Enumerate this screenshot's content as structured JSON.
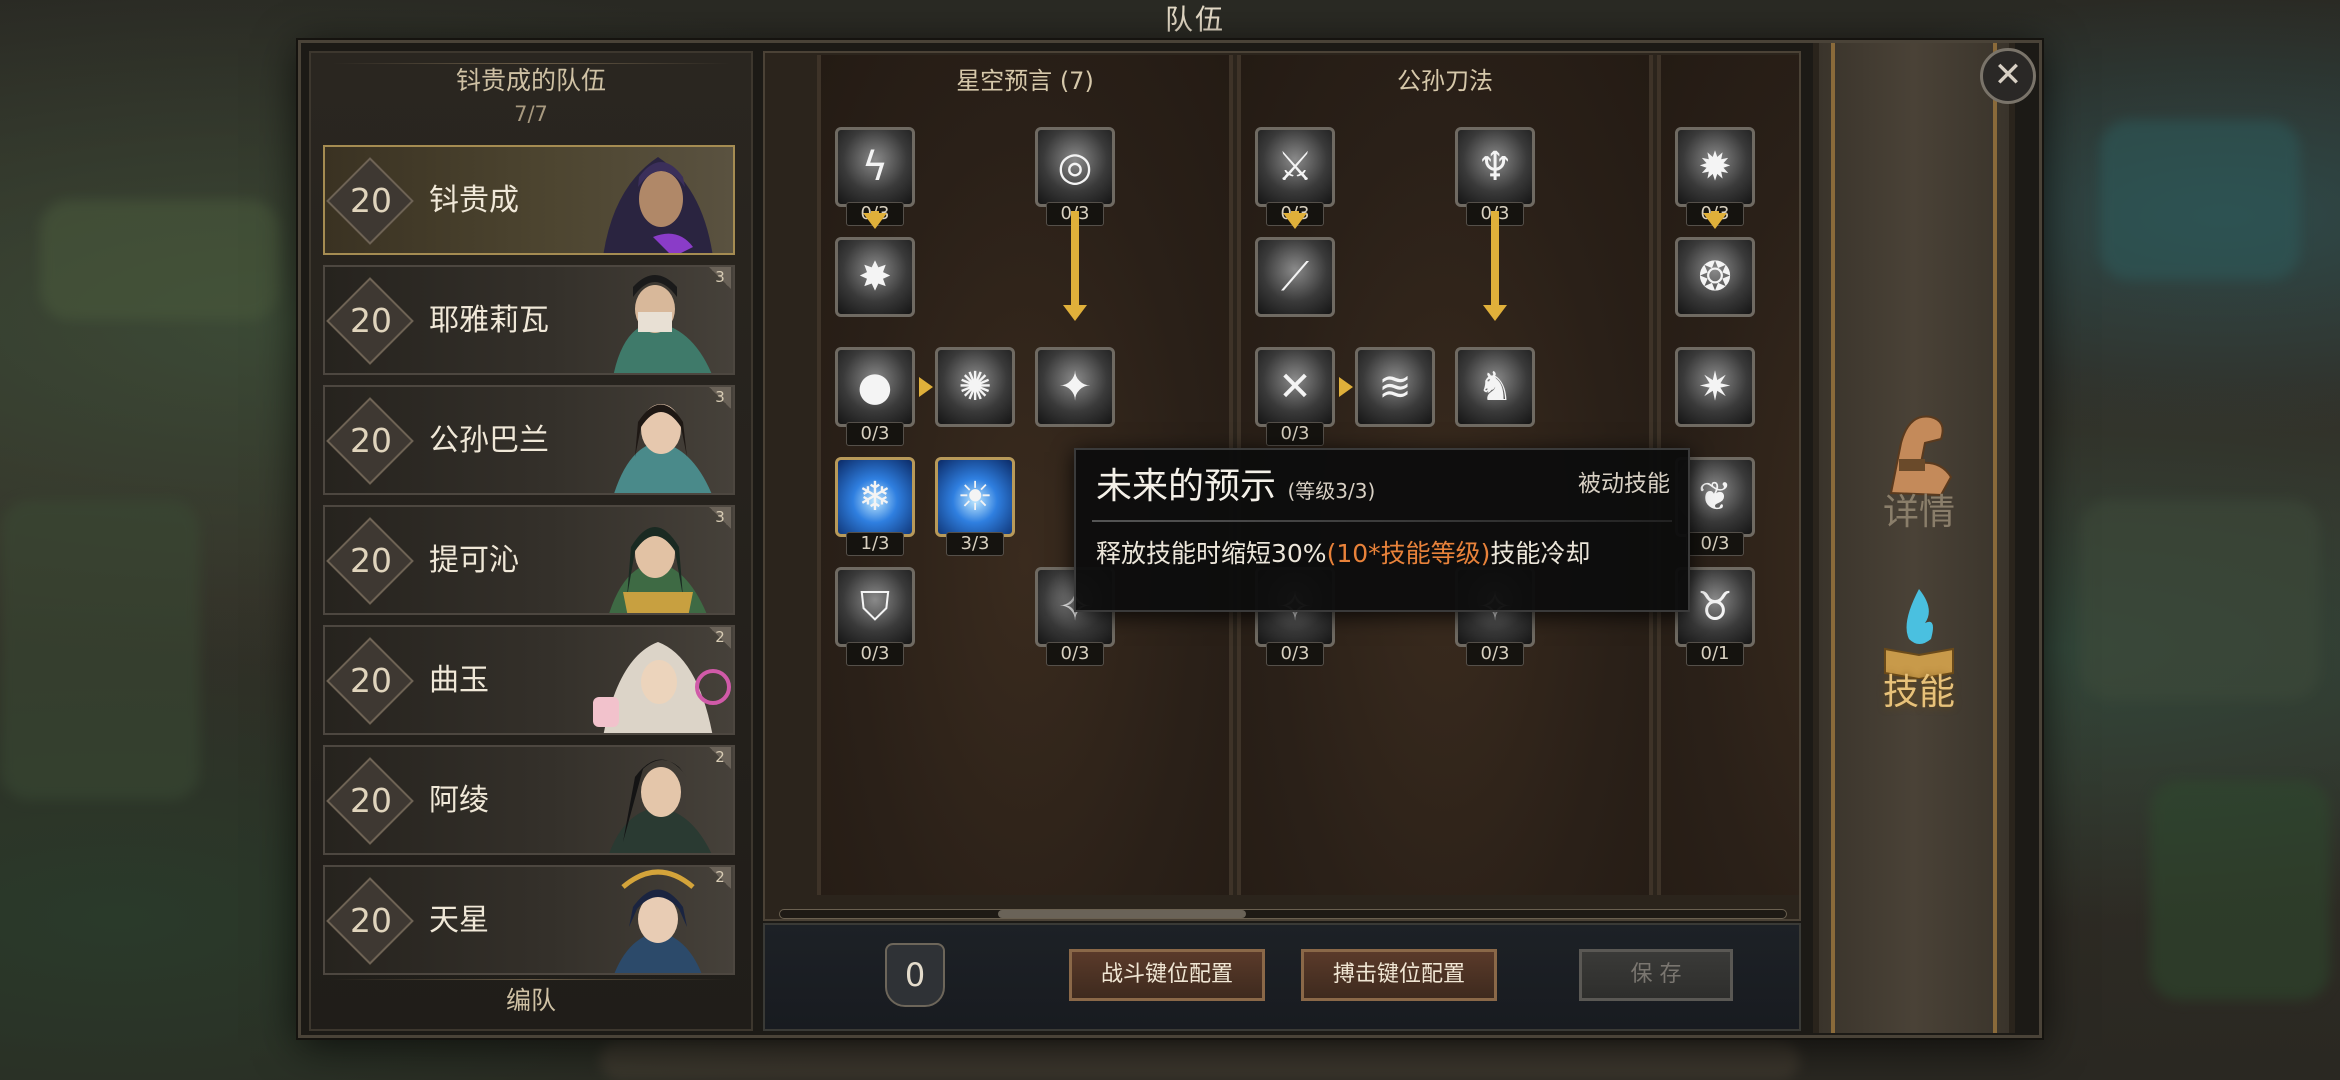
{
  "header": {
    "title": "队伍"
  },
  "roster": {
    "title": "钭贵成的队伍",
    "count": "7/7",
    "footer": "编队",
    "members": [
      {
        "level": "20",
        "name": "钭贵成",
        "badge": ""
      },
      {
        "level": "20",
        "name": "耶雅莉瓦",
        "badge": "3"
      },
      {
        "level": "20",
        "name": "公孙巴兰",
        "badge": "3"
      },
      {
        "level": "20",
        "name": "提可沁",
        "badge": "3"
      },
      {
        "level": "20",
        "name": "曲玉",
        "badge": "2"
      },
      {
        "level": "20",
        "name": "阿绫",
        "badge": "2"
      },
      {
        "level": "20",
        "name": "天星",
        "badge": "2"
      }
    ]
  },
  "skill_trees": [
    {
      "title": "星空预言 (7)",
      "nodes": [
        "0/3",
        "0/3",
        "0/3",
        "1/3",
        "3/3",
        "0/3",
        "0/3"
      ]
    },
    {
      "title": "公孙刀法",
      "nodes": [
        "0/3",
        "0/3",
        "0/3",
        "0/3",
        "0/3"
      ]
    },
    {
      "title": "",
      "nodes": [
        "0/3",
        "0/3",
        "0/1"
      ]
    }
  ],
  "tooltip": {
    "name": "未来的预示",
    "level": "(等级3/3)",
    "type": "被动技能",
    "desc_prefix": "释放技能时缩短30%",
    "desc_highlight": "(10*技能等级)",
    "desc_suffix": "技能冷却",
    "highlight_color": "#e8823a"
  },
  "bottom": {
    "points": "0",
    "battle_keys": "战斗键位配置",
    "grapple_keys": "搏击键位配置",
    "save": "保 存"
  },
  "tabs": {
    "details": "详情",
    "skills": "技能"
  },
  "close_glyph": "✕"
}
